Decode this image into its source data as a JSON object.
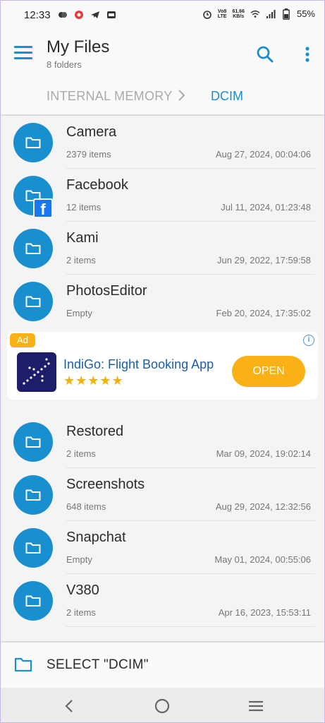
{
  "status_bar": {
    "time": "12:33",
    "net_speed_value": "61.66",
    "net_speed_unit": "KB/s",
    "network_type": "LTE",
    "volte": "Vo8",
    "battery": "55%"
  },
  "header": {
    "title": "My Files",
    "subtitle": "8 folders"
  },
  "breadcrumb": {
    "parent": "INTERNAL MEMORY",
    "current": "DCIM"
  },
  "folders_top": [
    {
      "name": "Camera",
      "count": "2379 items",
      "date": "Aug 27, 2024, 00:04:06"
    },
    {
      "name": "Facebook",
      "count": "12 items",
      "date": "Jul 11, 2024, 01:23:48"
    },
    {
      "name": "Kami",
      "count": "2 items",
      "date": "Jun 29, 2022, 17:59:58"
    },
    {
      "name": "PhotosEditor",
      "count": "Empty",
      "date": "Feb 20, 2024, 17:35:02"
    }
  ],
  "ad": {
    "badge": "Ad",
    "title": "IndiGo: Flight Booking App",
    "rating": 4.5,
    "stars": "★★★★★",
    "button": "OPEN",
    "info": "i"
  },
  "folders_bottom": [
    {
      "name": "Restored",
      "count": "2 items",
      "date": "Mar 09, 2024, 19:02:14"
    },
    {
      "name": "Screenshots",
      "count": "648 items",
      "date": "Aug 29, 2024, 12:32:56"
    },
    {
      "name": "Snapchat",
      "count": "Empty",
      "date": "May 01, 2024, 00:55:06"
    },
    {
      "name": "V380",
      "count": "2 items",
      "date": "Apr 16, 2023, 15:53:11"
    }
  ],
  "select_bar": {
    "label": "SELECT \"DCIM\""
  },
  "colors": {
    "accent": "#1a8fd0",
    "ad_yellow": "#f9b115",
    "star": "#f5b000",
    "facebook": "#1877f2"
  },
  "icons": {
    "menu": "hamburger-icon",
    "search": "search-icon",
    "more": "more-vert-icon",
    "folder": "folder-icon",
    "back": "nav-back-icon",
    "home": "nav-home-icon",
    "recents": "nav-recents-icon"
  }
}
